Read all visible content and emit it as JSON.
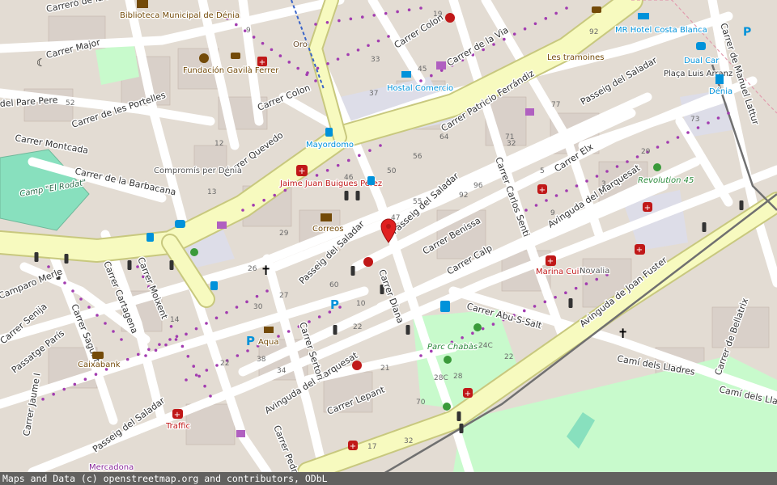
{
  "attribution": "Maps and Data (c) openstreetmap.org and contributors, ODbL",
  "colors": {
    "background": "#e3dcd3",
    "building": "#d9d0c9",
    "primary_road": "#f7fabf",
    "primary_casing": "#c8c87e",
    "pedestrian": "#dddde8",
    "park": "#c8facc",
    "pitch": "#88e0be",
    "railway": "#707070",
    "marker": "#e02020",
    "poi_brown": "#734a08",
    "poi_blue": "#0092da",
    "poi_red": "#c01818",
    "poi_purple": "#8a2a9a"
  },
  "marker": {
    "name": "location-pin",
    "color": "#e02020"
  },
  "streets": [
    "Carreró de la Mora",
    "Carrer Major",
    "del Pare Pere",
    "Carrer de les Portelles",
    "Carrer Montcada",
    "Carrer de la Barbacana",
    "Carrer Quevedo",
    "Carrer Colon",
    "Carrer Colon",
    "Carrer de la Via",
    "Carrer Patricio Ferrándiz",
    "Passeig del Saladar",
    "Carrer Elx",
    "Carrer Carlos Senti",
    "Avinguda del Marquesat",
    "Passeig del Saladar",
    "Passeig del Saladar",
    "Carrer Benissa",
    "Carrer Calp",
    "Carrer Diana",
    "Carrer Abu-S-Salt",
    "Avinguda de Joan Fuster",
    "Camí dels Lladres",
    "Camí dels Lladres",
    "Carrer de Bellatrix",
    "Carrer de Manuel Lattur",
    "Carrer Moixent",
    "Carrer Cartagena",
    "Carrer Sagunt",
    "Carrer Senija",
    "Passatge París",
    "Avinguda del Marquesat",
    "Carrer Sertori",
    "Passeig del Saladar",
    "Carrer Lepant",
    "Carrer Pedrego",
    "Carrer Jaume I",
    "Camparo Merle"
  ],
  "pois": [
    "Biblioteca Municipal de Dénia",
    "Fundación Gavilà Ferrer",
    "Oro",
    "Hostal Comercio",
    "Mayordomo",
    "MR Hotel Costa Blanca",
    "Les tramoines",
    "Dual Car",
    "Plaça Luis Arranz",
    "Dénia",
    "Compromís per Dénia",
    "Jaime Juan Buigues Pérez",
    "Correos",
    "Camp \"El Rodat\"",
    "Revolution 45",
    "Marina Cuines",
    "Novalia",
    "Parc Chabàs",
    "Aqua",
    "Caixabank",
    "Traffic",
    "Mercadona"
  ],
  "house_numbers": [
    "19",
    "9",
    "33",
    "45",
    "92",
    "37",
    "56",
    "64",
    "71",
    "77",
    "32",
    "46",
    "50",
    "55",
    "92",
    "96",
    "47",
    "29",
    "26",
    "60",
    "30",
    "27",
    "14",
    "38",
    "22",
    "10",
    "5",
    "9",
    "3",
    "24C",
    "22",
    "28C",
    "28",
    "70",
    "32",
    "17",
    "29",
    "73",
    "21",
    "22",
    "34",
    "52",
    "12",
    "13"
  ],
  "icons": [
    "theatre-icon",
    "place-of-worship-icon",
    "parking-icon",
    "bus-stop-icon",
    "pharmacy-icon",
    "hotel-icon",
    "post-office-icon",
    "bank-icon",
    "fitness-icon",
    "playground-icon",
    "shop-icon",
    "car-rental-icon",
    "restaurant-icon",
    "fuel-icon",
    "railway-station-icon",
    "library-icon"
  ]
}
